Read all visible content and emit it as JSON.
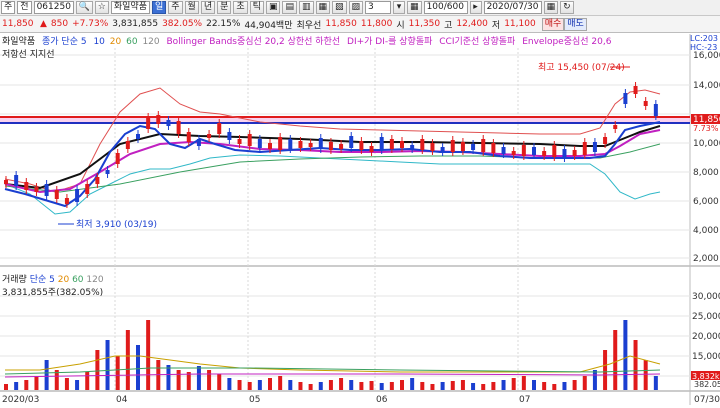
{
  "toolbar": {
    "menu_label": "주",
    "type_select": "전",
    "code": "061250",
    "name_badge": "☆",
    "stock_name": "화일약품",
    "period_tabs": [
      "일",
      "주",
      "월",
      "년",
      "분",
      "초",
      "틱"
    ],
    "interval_value": "3",
    "count_value": "100/600",
    "date_value": "2020/07/30"
  },
  "quote": {
    "price": "11,850",
    "change_arrow": "▲",
    "change": "850",
    "change_pct": "+7.73%",
    "volume": "3,831,855",
    "volume_ratio": "382.05%",
    "turnover": "22.15%",
    "amount": "44,904백만",
    "best_label": "최우선",
    "ask": "11,850",
    "bid": "11,800",
    "open_label": "시",
    "open": "11,350",
    "high_label": "고",
    "high": "12,400",
    "low_label": "저",
    "low": "11,100",
    "buy_label": "매수",
    "sell_label": "매도"
  },
  "legend": {
    "name": "화일약품",
    "close_ma": "종가 단순 5",
    "ma10": "10",
    "ma20": "20",
    "ma60": "60",
    "ma120": "120",
    "bollinger": "Bollinger Bands중심선 20,2 상한선 하한선",
    "dmi": "DI+가 DI-를 상향돌파",
    "cci": "CCI기준선 상향돌파",
    "envelope": "Envelope중심선 20,6",
    "line2": "저항선 지지선",
    "lc_label": "LC:203",
    "hc_label": "HC:-23"
  },
  "annotations": {
    "high_note": "최고 15,450 (07/24)",
    "low_note": "최저 3,910 (03/19)",
    "price_tag": "11,850",
    "pct_tag": "7.73%"
  },
  "volume_legend": {
    "label": "거래량",
    "ma_label": "단순 5",
    "ma20": "20",
    "ma60": "60",
    "ma120": "120",
    "value_line": "3,831,855주(382.05%)",
    "vol_tag": "3,832k",
    "vol_pct_tag": "382.05"
  },
  "price_axis": [
    "16,000",
    "14,000",
    "12,000",
    "10,000",
    "8,000",
    "6,000",
    "4,000",
    "2,000"
  ],
  "volume_axis": [
    "30,000",
    "25,000",
    "20,000",
    "15,000",
    "10,000",
    "5,000"
  ],
  "date_axis": [
    "2020/03",
    "04",
    "05",
    "06",
    "07",
    "07/30"
  ],
  "colors": {
    "up": "#e01b1b",
    "down": "#1a3fd0",
    "bb": "#e05050",
    "lower_bb": "#30b8c8",
    "ma5": "#1a3fd0",
    "ma20": "#c020c0",
    "ma60": "#111111",
    "env": "#d070d0"
  }
}
